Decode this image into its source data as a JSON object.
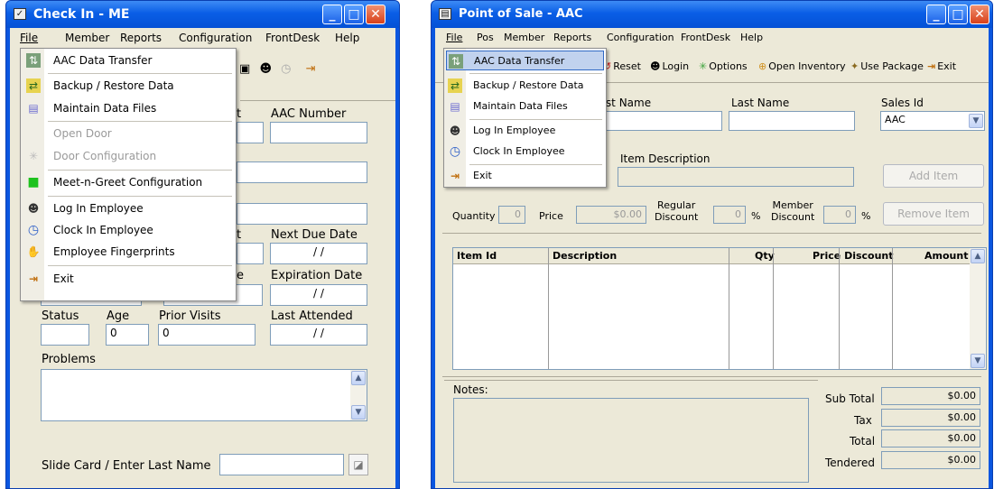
{
  "left": {
    "title": "Check In - ME",
    "menu": [
      "File",
      "Member",
      "Reports",
      "Configuration",
      "FrontDesk",
      "Help"
    ],
    "labels": {
      "aac_number": "AAC Number",
      "next_due": "Next Due Date",
      "expiration": "Expiration Date",
      "status": "Status",
      "age": "Age",
      "prior_visits": "Prior Visits",
      "last_attended": "Last Attended",
      "problems": "Problems",
      "slide_card": "Slide Card / Enter Last Name"
    },
    "frag_t": "t",
    "frag_e": "e",
    "values": {
      "next_due": "/ /",
      "expiration": "/ /",
      "age": "0",
      "prior_visits": "0",
      "last_attended": "/ /",
      "peek": "/ /"
    },
    "file_menu": [
      {
        "label": "AAC Data Transfer",
        "icon": "data-transfer-icon",
        "glyph": "⇅"
      },
      {
        "label": "Backup / Restore Data",
        "icon": "backup-icon",
        "glyph": "⇄"
      },
      {
        "label": "Maintain Data Files",
        "icon": "files-icon",
        "glyph": "▤"
      },
      {
        "label": "Open Door",
        "icon": "",
        "glyph": ""
      },
      {
        "label": "Door Configuration",
        "icon": "door-config-icon",
        "glyph": "✳"
      },
      {
        "label": "Meet-n-Greet Configuration",
        "icon": "green-square-icon",
        "glyph": "■"
      },
      {
        "label": "Log In Employee",
        "icon": "employee-icon",
        "glyph": "☻"
      },
      {
        "label": "Clock In Employee",
        "icon": "clock-icon",
        "glyph": "◷"
      },
      {
        "label": "Employee Fingerprints",
        "icon": "hand-icon",
        "glyph": "✋"
      },
      {
        "label": "Exit",
        "icon": "exit-icon",
        "glyph": "⇥"
      }
    ]
  },
  "right": {
    "title": "Point of Sale - AAC",
    "menu": [
      "File",
      "Pos",
      "Member",
      "Reports",
      "Configuration",
      "FrontDesk",
      "Help"
    ],
    "toolbar": [
      {
        "label": "Reset",
        "icon": "reset-icon",
        "glyph": "↺"
      },
      {
        "label": "Login",
        "icon": "login-icon",
        "glyph": "☻"
      },
      {
        "label": "Options",
        "icon": "options-icon",
        "glyph": "✳"
      },
      {
        "label": "Open Inventory",
        "icon": "inventory-icon",
        "glyph": "⊕"
      },
      {
        "label": "Use Package",
        "icon": "package-icon",
        "glyph": "✦"
      },
      {
        "label": "Exit",
        "icon": "exit-icon",
        "glyph": "⇥"
      }
    ],
    "labels": {
      "first_name_frag": "rst Name",
      "last_name": "Last Name",
      "sales_id": "Sales Id",
      "item_description": "Item Description",
      "quantity": "Quantity",
      "price": "Price",
      "regular_discount": "Regular\nDiscount",
      "member_discount": "Member\nDiscount",
      "pct": "%",
      "notes": "Notes:",
      "sub_total": "Sub Total",
      "tax": "Tax",
      "total": "Total",
      "tendered": "Tendered"
    },
    "values": {
      "sales_id": "AAC",
      "quantity": "0",
      "price": "$0.00",
      "regular_discount": "0",
      "member_discount": "0",
      "sub_total": "$0.00",
      "tax": "$0.00",
      "total": "$0.00",
      "tendered": "$0.00"
    },
    "buttons": {
      "add_item": "Add Item",
      "remove_item": "Remove Item"
    },
    "grid_headers": [
      "Item Id",
      "Description",
      "Qty",
      "Price Discount",
      "Amount"
    ],
    "file_menu": [
      {
        "label": "AAC Data Transfer",
        "icon": "data-transfer-icon",
        "glyph": "⇅"
      },
      {
        "label": "Backup / Restore Data",
        "icon": "backup-icon",
        "glyph": "⇄"
      },
      {
        "label": "Maintain Data Files",
        "icon": "files-icon",
        "glyph": "▤"
      },
      {
        "label": "Log In Employee",
        "icon": "employee-icon",
        "glyph": "☻"
      },
      {
        "label": "Clock In Employee",
        "icon": "clock-icon",
        "glyph": "◷"
      },
      {
        "label": "Exit",
        "icon": "exit-icon",
        "glyph": "⇥"
      }
    ]
  }
}
